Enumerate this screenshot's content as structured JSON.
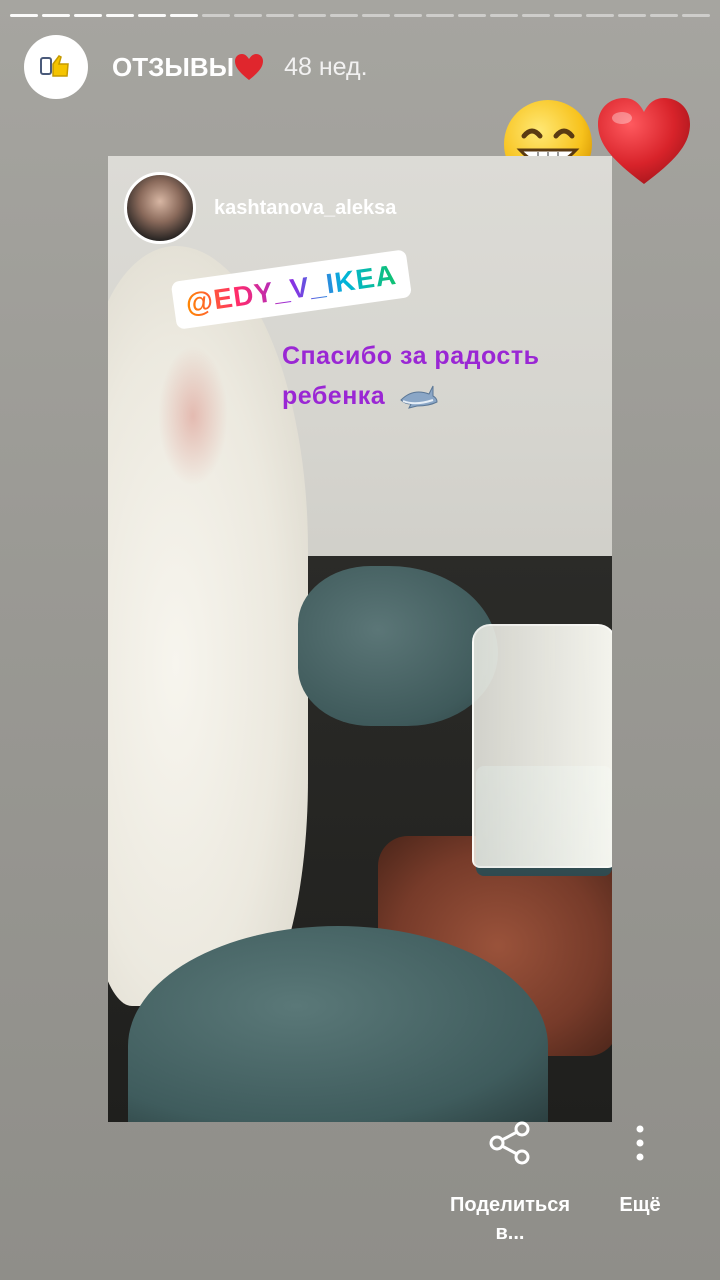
{
  "story": {
    "segments_total": 22,
    "segments_done": 6,
    "account_title": "ОТЗЫВЫ",
    "time_ago": "48 нед."
  },
  "post": {
    "username": "kashtanova_aleksa",
    "mention": "@EDY_V_IKEA",
    "caption": "Спасибо за радость ребенка"
  },
  "actions": {
    "share_label": "Поделиться в...",
    "more_label": "Ещё"
  },
  "colors": {
    "caption": "#9a27d4",
    "heart": "#d8232a"
  },
  "icons": {
    "grin": "grin-emoji-icon",
    "heart": "heart-icon",
    "shark": "shark-emoji-icon",
    "share": "share-icon",
    "more": "more-vertical-icon"
  }
}
